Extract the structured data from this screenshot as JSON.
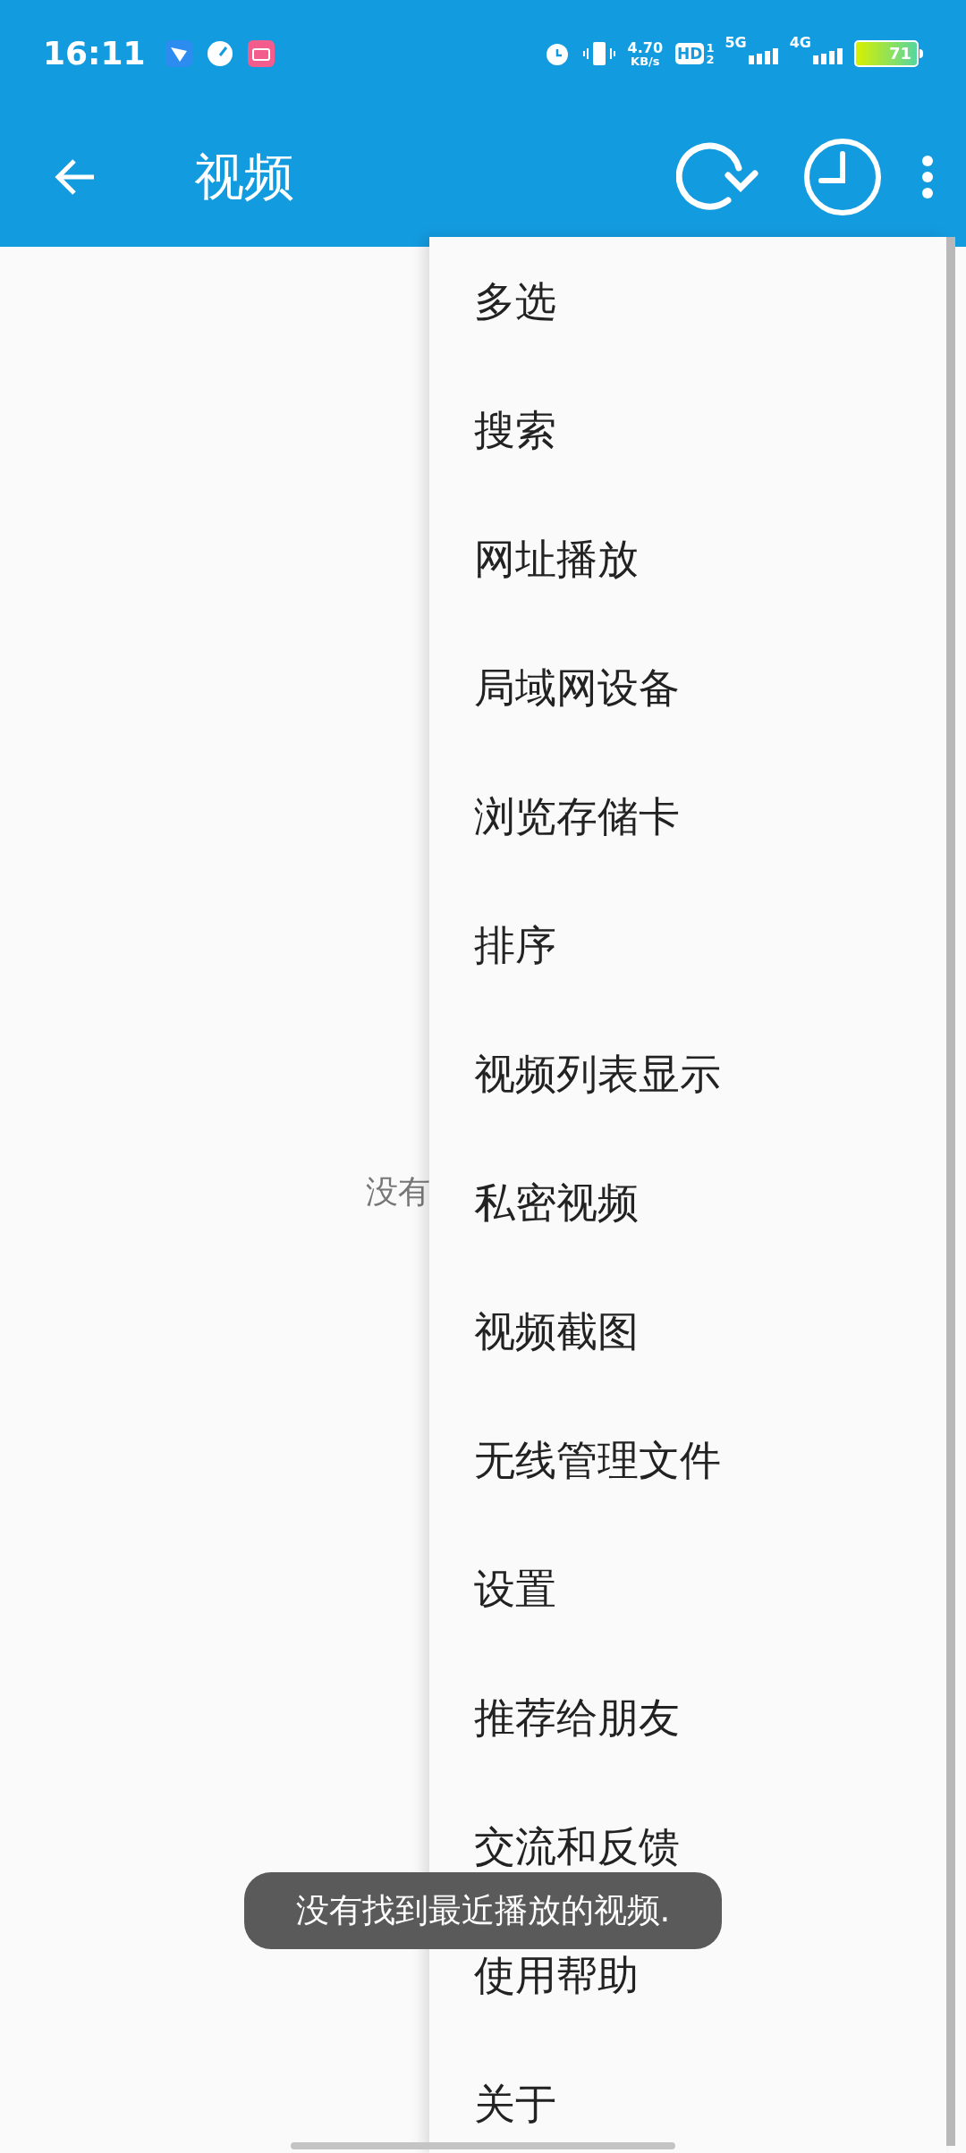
{
  "status_bar": {
    "time": "16:11",
    "net_speed": "4.70",
    "net_unit": "KB/s",
    "hd": "HD",
    "sim_1": "1",
    "sim_2": "2",
    "network_1": "5G",
    "network_2": "4G",
    "battery": "71"
  },
  "app_bar": {
    "title": "视频"
  },
  "empty_text": "没有",
  "menu": {
    "items": [
      {
        "label": "多选"
      },
      {
        "label": "搜索"
      },
      {
        "label": "网址播放"
      },
      {
        "label": "局域网设备"
      },
      {
        "label": "浏览存储卡"
      },
      {
        "label": "排序"
      },
      {
        "label": "视频列表显示"
      },
      {
        "label": "私密视频"
      },
      {
        "label": "视频截图"
      },
      {
        "label": "无线管理文件"
      },
      {
        "label": "设置"
      },
      {
        "label": "推荐给朋友"
      },
      {
        "label": "交流和反馈"
      },
      {
        "label": "使用帮助"
      },
      {
        "label": "关于"
      }
    ]
  },
  "toast": "没有找到最近播放的视频."
}
